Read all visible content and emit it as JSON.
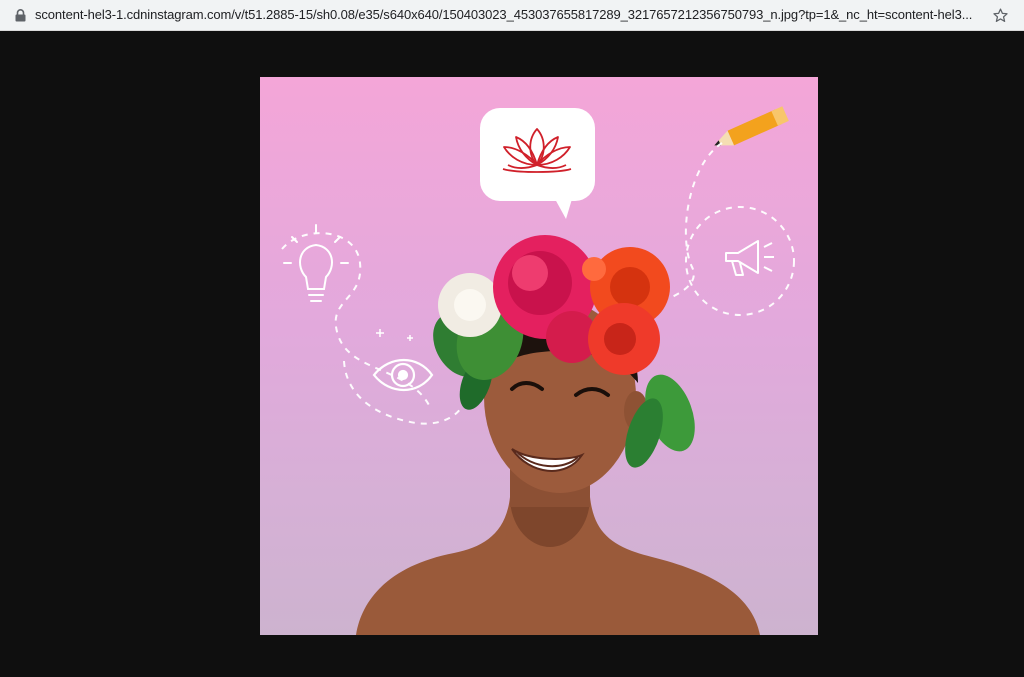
{
  "address_bar": {
    "url": "scontent-hel3-1.cdninstagram.com/v/t51.2885-15/sh0.08/e35/s640x640/150403023_453037655817289_3217657212356750793_n.jpg?tp=1&_nc_ht=scontent-hel3...",
    "security_icon": "lock-icon",
    "bookmark_icon": "star-icon"
  },
  "viewer": {
    "background_color": "#0f0f0f"
  },
  "image": {
    "icons": [
      "lotus-icon",
      "pencil-icon",
      "lightbulb-icon",
      "eye-icon",
      "megaphone-icon"
    ],
    "colors": {
      "background_top": "#f4a6d8",
      "background_bottom": "#cdb3cf",
      "lotus": "#d0202a",
      "pencil": "#f3a21d"
    }
  }
}
